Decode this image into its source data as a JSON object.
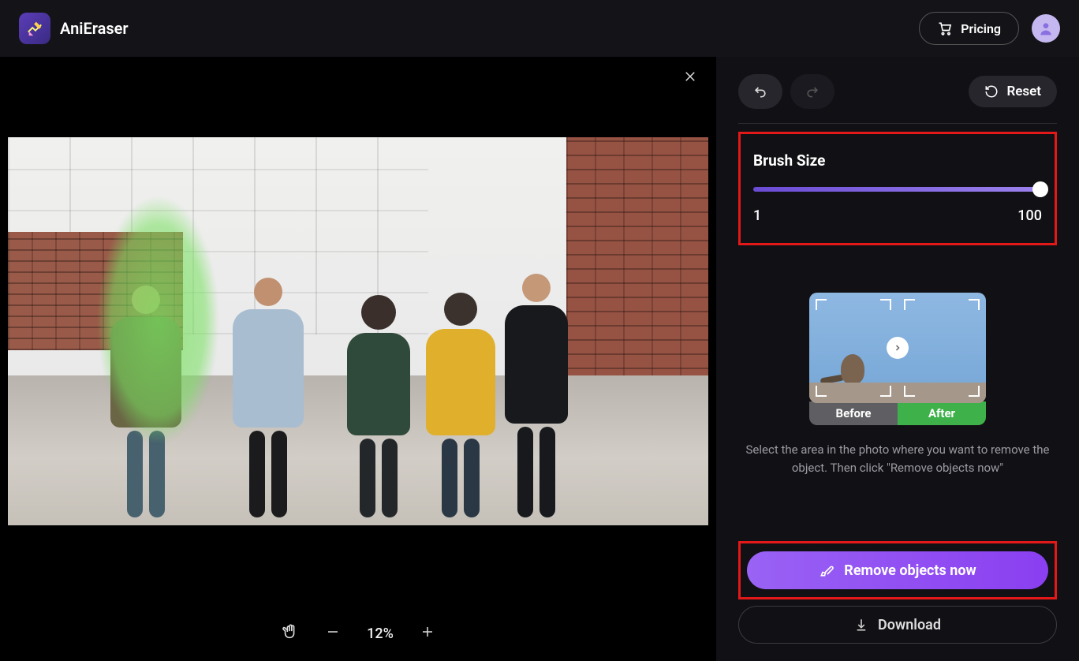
{
  "header": {
    "app_name": "AniEraser",
    "pricing_label": "Pricing"
  },
  "canvas": {
    "zoom_percent": "12%"
  },
  "sidebar": {
    "reset_label": "Reset",
    "brush": {
      "title": "Brush Size",
      "min": "1",
      "max": "100",
      "value": 100
    },
    "preview": {
      "before_label": "Before",
      "after_label": "After"
    },
    "hint_text": "Select the area in the photo where you want to remove the object. Then click \"Remove objects now\"",
    "remove_label": "Remove objects now",
    "download_label": "Download"
  }
}
